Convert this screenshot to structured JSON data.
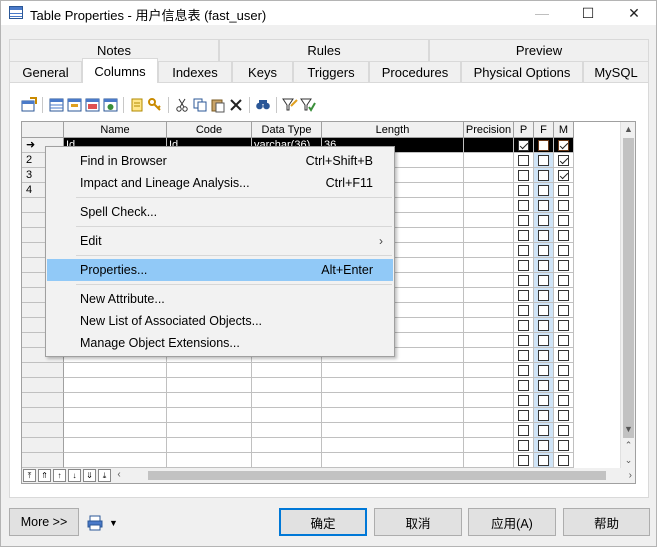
{
  "window": {
    "title": "Table Properties - 用户信息表 (fast_user)",
    "controls": {
      "minimize": "—",
      "maximize": "☐",
      "close": "✕"
    }
  },
  "tabs": {
    "row1": [
      "Notes",
      "Rules",
      "Preview"
    ],
    "row2": [
      "General",
      "Columns",
      "Indexes",
      "Keys",
      "Triggers",
      "Procedures",
      "Physical Options",
      "MySQL"
    ],
    "active": "Columns"
  },
  "grid": {
    "headers": [
      "",
      "Name",
      "Code",
      "Data Type",
      "Length",
      "Precision",
      "P",
      "F",
      "M"
    ],
    "rows": [
      {
        "rh": "➜",
        "name": "Id",
        "code": "Id",
        "type": "varchar(36)",
        "length": "36",
        "precision": "",
        "p": true,
        "f": false,
        "m": true
      },
      {
        "rh": "2",
        "name": "",
        "code": "",
        "type": "",
        "length": "",
        "precision": "",
        "p": false,
        "f": false,
        "m": true
      },
      {
        "rh": "3",
        "name": "",
        "code": "",
        "type": "",
        "length": "",
        "precision": "",
        "p": false,
        "f": false,
        "m": true
      },
      {
        "rh": "4",
        "name": "",
        "code": "",
        "type": "",
        "length": "",
        "precision": "",
        "p": false,
        "f": false,
        "m": false
      }
    ]
  },
  "context_menu": {
    "items": [
      {
        "label": "Find in Browser",
        "shortcut": "Ctrl+Shift+B"
      },
      {
        "label": "Impact and Lineage Analysis...",
        "shortcut": "Ctrl+F11"
      },
      {
        "label": "Spell Check...",
        "shortcut": ""
      },
      {
        "label": "Edit",
        "shortcut": ""
      },
      {
        "label": "Properties...",
        "shortcut": "Alt+Enter"
      },
      {
        "label": "New Attribute...",
        "shortcut": ""
      },
      {
        "label": "New List of Associated Objects...",
        "shortcut": ""
      },
      {
        "label": "Manage Object Extensions...",
        "shortcut": ""
      }
    ],
    "submenu_arrow": "›"
  },
  "buttons": {
    "more": "More >>",
    "ok": "确定",
    "cancel": "取消",
    "apply": "应用(A)",
    "help": "帮助"
  },
  "colors": {
    "accent": "#0078d7",
    "highlight": "#91c9f7",
    "f_column": "#cfe4f7"
  }
}
